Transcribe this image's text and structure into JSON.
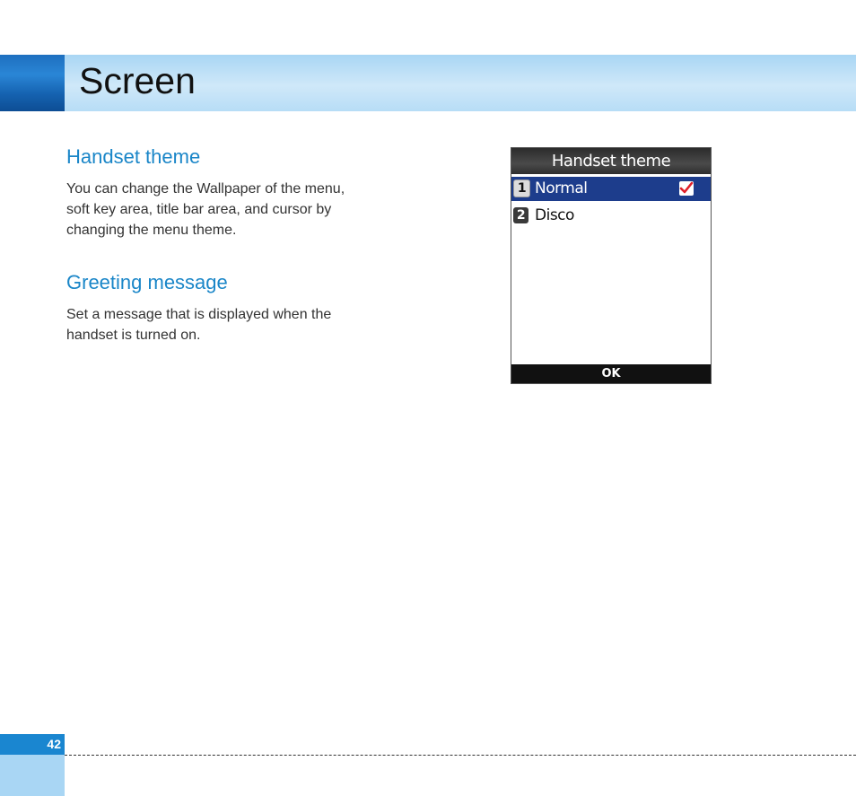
{
  "header": {
    "title": "Screen"
  },
  "sections": [
    {
      "title": "Handset theme",
      "lines": [
        "You can change the Wallpaper of the menu,",
        "soft key area, title bar area, and cursor by",
        "changing the menu theme."
      ]
    },
    {
      "title": "Greeting message",
      "lines": [
        "Set a message that is displayed when the",
        "handset is turned on."
      ]
    }
  ],
  "phone": {
    "title": "Handset theme",
    "items": [
      {
        "number": "1",
        "label": "Normal",
        "selected": true,
        "checked": true
      },
      {
        "number": "2",
        "label": "Disco",
        "selected": false,
        "checked": false
      }
    ],
    "softkey": "OK"
  },
  "colors": {
    "accent": "#1a86c8",
    "header_band": "#cfe8f9",
    "selection": "#1d3d8c",
    "check": "#e0202a"
  },
  "icons": {
    "check": "check-mark-icon"
  },
  "footer": {
    "page_number": "42"
  }
}
